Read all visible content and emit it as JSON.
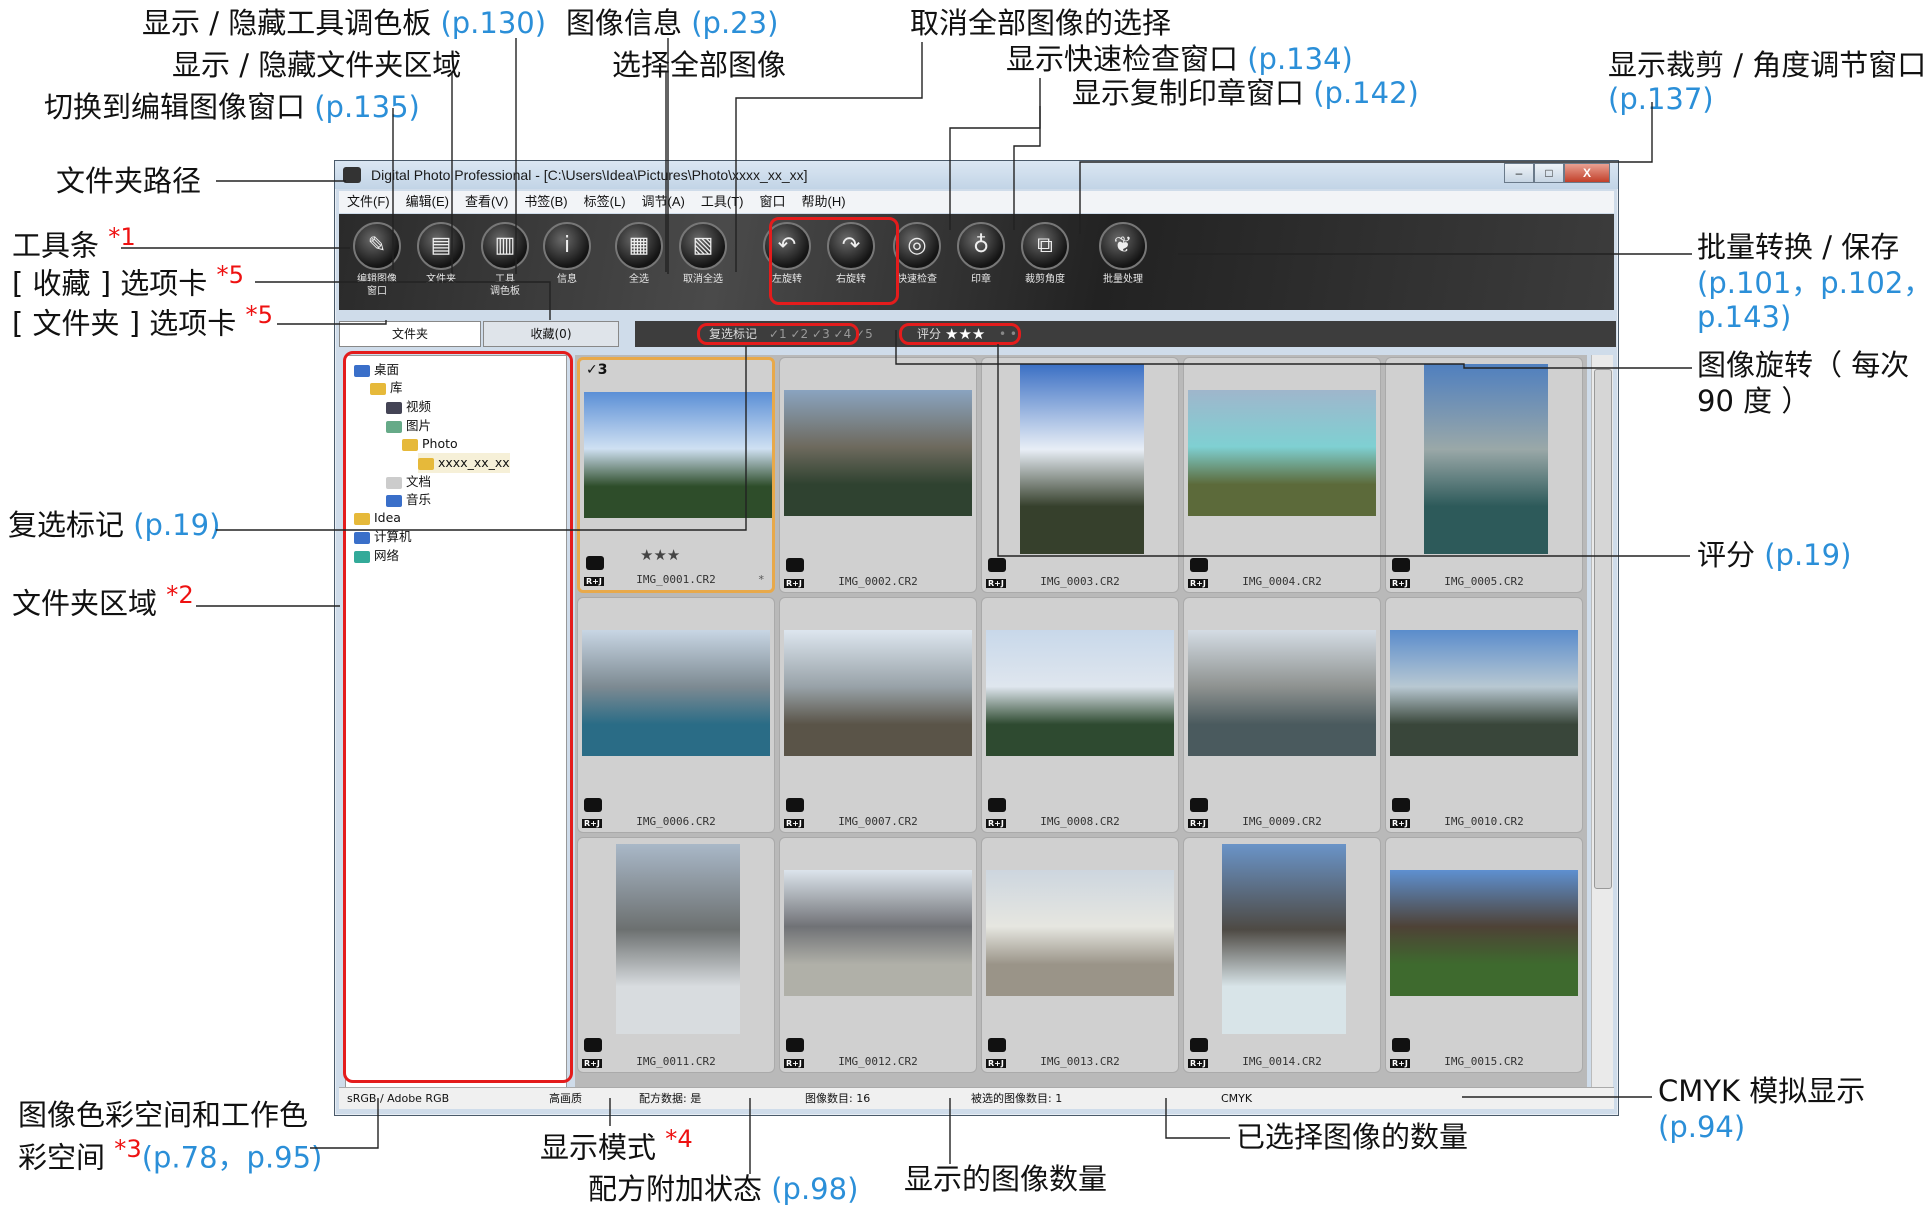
{
  "annotations": {
    "palette": "显示 / 隐藏工具调色板",
    "palette_page": "(p.130)",
    "image_info": "图像信息",
    "image_info_page": "(p.23)",
    "deselect": "取消全部图像的选择",
    "folder_area_toggle": "显示 / 隐藏文件夹区域",
    "select_all": "选择全部图像",
    "quick_check": "显示快速检查窗口",
    "quick_check_page": "(p.134)",
    "trim": "显示裁剪 / 角度调节窗口",
    "trim_page": "(p.137)",
    "stamp": "显示复制印章窗口",
    "stamp_page": "(p.142)",
    "edit_image": "切换到编辑图像窗口",
    "edit_image_page": "(p.135)",
    "folder_path": "文件夹路径",
    "toolbar": "工具条",
    "toolbar_note": "*1",
    "fav_tab": "[ 收藏 ] 选项卡",
    "fav_tab_note": "*5",
    "folder_tab": "[ 文件夹 ] 选项卡",
    "folder_tab_note": "*5",
    "batch": "批量转换 / 保存",
    "batch_pages1": "(p.101，p.102，",
    "batch_pages2": "p.143)",
    "rotate1": "图像旋转（ 每次",
    "rotate2": "90 度 ）",
    "check_mark": "复选标记",
    "check_mark_page": "(p.19)",
    "rating": "评分",
    "rating_page": "(p.19)",
    "folder_area": "文件夹区域",
    "folder_area_note": "*2",
    "color_space1": "图像色彩空间和工作色",
    "color_space2": "彩空间",
    "color_space_note": "*3",
    "color_space_pages": "(p.78，p.95)",
    "display_mode": "显示模式",
    "display_mode_note": "*4",
    "recipe_state": "配方附加状态",
    "recipe_state_page": "(p.98)",
    "image_count": "显示的图像数量",
    "selected_count": "已选择图像的数量",
    "cmyk": "CMYK 模拟显示",
    "cmyk_page": "(p.94)"
  },
  "window": {
    "title": "Digital Photo Professional - [C:\\Users\\Idea\\Pictures\\Photo\\xxxx_xx_xx]",
    "min": "–",
    "max": "□",
    "close": "X"
  },
  "menu": [
    "文件(F)",
    "编辑(E)",
    "查看(V)",
    "书签(B)",
    "标签(L)",
    "调节(A)",
    "工具(T)",
    "窗口",
    "帮助(H)"
  ],
  "toolbar_buttons": [
    {
      "label": "编辑图像\n窗口",
      "icon": "edit-window-icon",
      "glyph": "✎"
    },
    {
      "label": "文件夹",
      "icon": "folder-icon",
      "glyph": "▤"
    },
    {
      "label": "工具\n调色板",
      "icon": "palette-icon",
      "glyph": "▥"
    },
    {
      "label": "信息",
      "icon": "info-icon",
      "glyph": "i"
    },
    {
      "label": "全选",
      "icon": "select-all-icon",
      "glyph": "▦"
    },
    {
      "label": "取消全选",
      "icon": "deselect-icon",
      "glyph": "▧"
    },
    {
      "label": "左旋转",
      "icon": "rotate-left-icon",
      "glyph": "↶"
    },
    {
      "label": "右旋转",
      "icon": "rotate-right-icon",
      "glyph": "↷"
    },
    {
      "label": "快速检查",
      "icon": "quick-check-icon",
      "glyph": "◎"
    },
    {
      "label": "印章",
      "icon": "stamp-icon",
      "glyph": "♁"
    },
    {
      "label": "裁剪角度",
      "icon": "trim-icon",
      "glyph": "⧉"
    },
    {
      "label": "批量处理",
      "icon": "batch-icon",
      "glyph": "❦"
    }
  ],
  "tabs": {
    "folder": "文件夹",
    "favorites": "收藏(0)"
  },
  "filter": {
    "check_label": "复选标记",
    "check_marks": "✓1 ✓2 ✓3 ✓4 ✓5",
    "rating_label": "评分",
    "rating_stars": "★★★",
    "rating_dots": "• •"
  },
  "tree": [
    {
      "label": "桌面",
      "color": "#3a6fc9"
    },
    {
      "label": "库",
      "color": "#e6b93a"
    },
    {
      "label": "视频",
      "color": "#445"
    },
    {
      "label": "图片",
      "color": "#6a8"
    },
    {
      "label": "Photo",
      "color": "#e6b93a"
    },
    {
      "label": "xxxx_xx_xx",
      "color": "#e6b93a"
    },
    {
      "label": "文档",
      "color": "#ccc"
    },
    {
      "label": "音乐",
      "color": "#3a6fc9"
    },
    {
      "label": "Idea",
      "color": "#e6b93a"
    },
    {
      "label": "计算机",
      "color": "#3a6fc9"
    },
    {
      "label": "网络",
      "color": "#3a9"
    }
  ],
  "thumbnails": [
    {
      "name": "IMG_0001.CR2",
      "check": "✓3",
      "stars": "★★★",
      "extra": "*",
      "orient": "land",
      "colors": [
        "#5b8fd6",
        "#cfe0f2",
        "#2e4d2a"
      ]
    },
    {
      "name": "IMG_0002.CR2",
      "orient": "land",
      "colors": [
        "#8aa4c0",
        "#6e6a5e",
        "#2f4230"
      ]
    },
    {
      "name": "IMG_0003.CR2",
      "orient": "port",
      "colors": [
        "#3a6fc4",
        "#e8eef6",
        "#36402c"
      ]
    },
    {
      "name": "IMG_0004.CR2",
      "orient": "land",
      "colors": [
        "#9fb6cc",
        "#7fd0d2",
        "#5c6a3a"
      ]
    },
    {
      "name": "IMG_0005.CR2",
      "orient": "port",
      "colors": [
        "#4f7fbf",
        "#9aa8a8",
        "#2d5a5a"
      ]
    },
    {
      "name": "IMG_0006.CR2",
      "orient": "land",
      "colors": [
        "#c8d6e4",
        "#7d8a92",
        "#2a6c86"
      ]
    },
    {
      "name": "IMG_0007.CR2",
      "orient": "land",
      "colors": [
        "#dde6ef",
        "#98a2a8",
        "#5a5448"
      ]
    },
    {
      "name": "IMG_0008.CR2",
      "orient": "land",
      "colors": [
        "#c8d8ea",
        "#dfe6ee",
        "#2e4a30"
      ]
    },
    {
      "name": "IMG_0009.CR2",
      "orient": "land",
      "colors": [
        "#d4dce4",
        "#8e9290",
        "#4a5a5e"
      ]
    },
    {
      "name": "IMG_0010.CR2",
      "orient": "land",
      "colors": [
        "#5a8ccc",
        "#b8c8d2",
        "#39463a"
      ]
    },
    {
      "name": "IMG_0011.CR2",
      "orient": "port",
      "colors": [
        "#a9b8c8",
        "#6c7070",
        "#d8dcdf"
      ]
    },
    {
      "name": "IMG_0012.CR2",
      "orient": "land",
      "colors": [
        "#dce4ec",
        "#707276",
        "#b0b0a8"
      ]
    },
    {
      "name": "IMG_0013.CR2",
      "orient": "land",
      "colors": [
        "#cdd6df",
        "#e6e6e0",
        "#9a9488"
      ]
    },
    {
      "name": "IMG_0014.CR2",
      "orient": "port",
      "colors": [
        "#6a94c8",
        "#4e4a44",
        "#d8e4e8"
      ]
    },
    {
      "name": "IMG_0015.CR2",
      "orient": "land",
      "colors": [
        "#5e90d0",
        "#4e4236",
        "#3e6a2e"
      ]
    }
  ],
  "status": {
    "color_space": "sRGB / Adobe RGB",
    "quality": "高画质",
    "recipe": "配方数据: 是",
    "count": "图像数目: 16",
    "selected": "被选的图像数目: 1",
    "cmyk": "CMYK"
  }
}
